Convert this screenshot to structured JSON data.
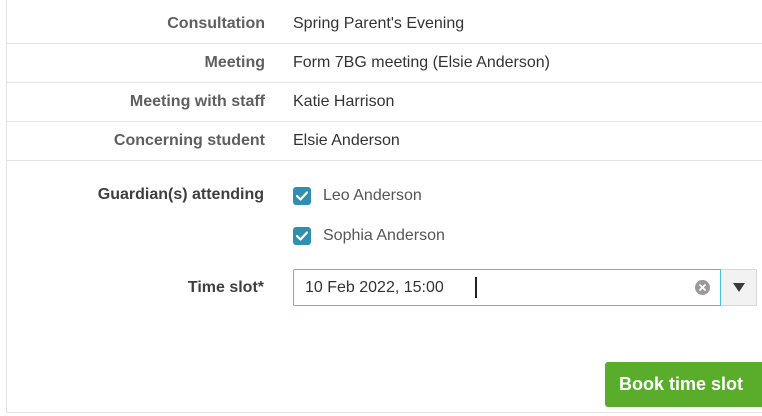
{
  "details": {
    "consultation_label": "Consultation",
    "consultation_value": "Spring Parent's Evening",
    "meeting_label": "Meeting",
    "meeting_value": "Form 7BG meeting (Elsie Anderson)",
    "staff_label": "Meeting with staff",
    "staff_value": "Katie Harrison",
    "student_label": "Concerning student",
    "student_value": "Elsie Anderson"
  },
  "guardians": {
    "label": "Guardian(s) attending",
    "items": [
      {
        "name": "Leo Anderson",
        "checked": true
      },
      {
        "name": "Sophia Anderson",
        "checked": true
      }
    ]
  },
  "time_slot": {
    "label": "Time slot*",
    "value": "10 Feb 2022, 15:00"
  },
  "actions": {
    "book_label": "Book time slot"
  },
  "colors": {
    "checkbox": "#2e8fb0",
    "input_focus_border": "#49c1d8",
    "primary_button": "#5aad2b"
  }
}
